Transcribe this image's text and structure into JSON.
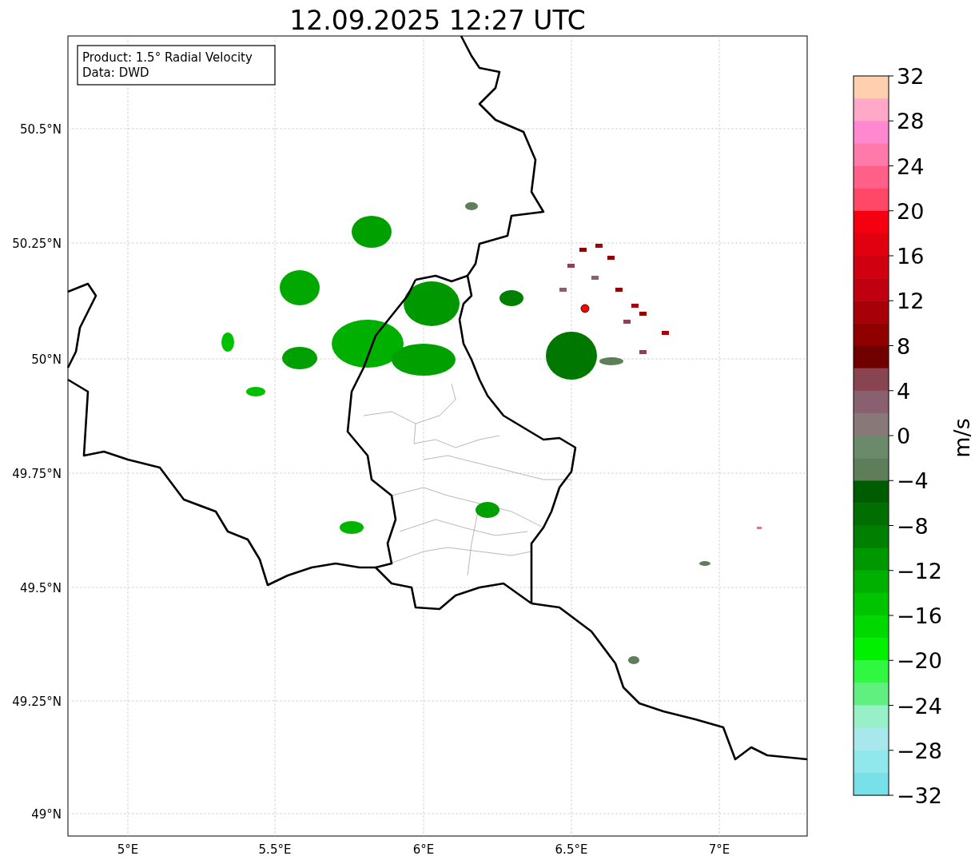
{
  "title": "12.09.2025 12:27 UTC",
  "info_box": [
    "Product: 1.5° Radial Velocity",
    "Data: DWD"
  ],
  "lat_ticks": [
    "50.5°N",
    "50.25°N",
    "50°N",
    "49.75°N",
    "49.5°N",
    "49.25°N",
    "49°N"
  ],
  "lon_ticks": [
    "5°E",
    "5.5°E",
    "6°E",
    "6.5°E",
    "7°E"
  ],
  "colorbar": {
    "label": "m/s",
    "ticks": [
      "32",
      "28",
      "24",
      "20",
      "16",
      "12",
      "8",
      "4",
      "0",
      "−4",
      "−8",
      "−12",
      "−16",
      "−20",
      "−24",
      "−28",
      "−32"
    ],
    "bins": [
      {
        "color": "#ffcfb0"
      },
      {
        "color": "#ffa8c8"
      },
      {
        "color": "#ff88d0"
      },
      {
        "color": "#ff7aa8"
      },
      {
        "color": "#ff6088"
      },
      {
        "color": "#ff4868"
      },
      {
        "color": "#f50010"
      },
      {
        "color": "#e00010"
      },
      {
        "color": "#d00010"
      },
      {
        "color": "#c00010"
      },
      {
        "color": "#a80008"
      },
      {
        "color": "#900000"
      },
      {
        "color": "#700000"
      },
      {
        "color": "#884450"
      },
      {
        "color": "#886070"
      },
      {
        "color": "#887878"
      },
      {
        "color": "#6a8a6a"
      },
      {
        "color": "#5e7e5a"
      },
      {
        "color": "#005c00"
      },
      {
        "color": "#006e00"
      },
      {
        "color": "#008000"
      },
      {
        "color": "#009800"
      },
      {
        "color": "#00b000"
      },
      {
        "color": "#00c400"
      },
      {
        "color": "#00d800"
      },
      {
        "color": "#00f000"
      },
      {
        "color": "#30f840"
      },
      {
        "color": "#60f080"
      },
      {
        "color": "#98f0c8"
      },
      {
        "color": "#a8e8ec"
      },
      {
        "color": "#90e8ec"
      },
      {
        "color": "#78e0e8"
      }
    ]
  }
}
